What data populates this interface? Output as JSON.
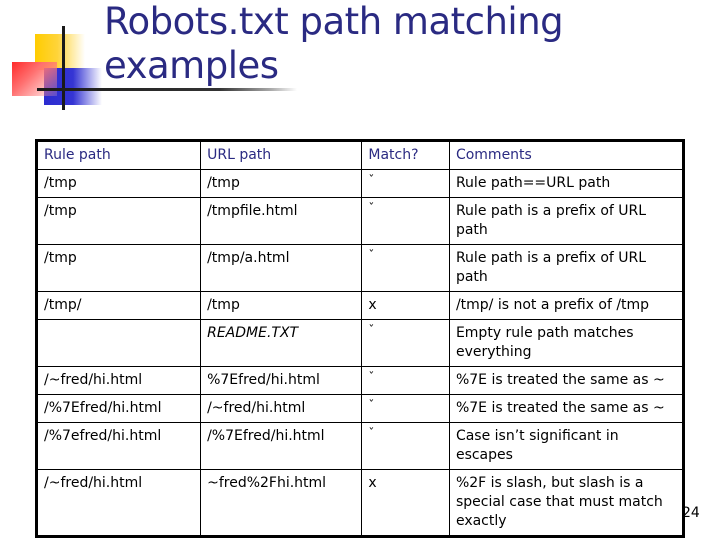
{
  "slide": {
    "title_line1": "Robots.txt path matching",
    "title_line2": "examples",
    "page_number": "24",
    "accent_color": "#2a2a82"
  },
  "table": {
    "headers": [
      "Rule path",
      "URL path",
      "Match?",
      "Comments"
    ],
    "rows": [
      {
        "rule": "/tmp",
        "url": "/tmp",
        "match": "ˇ",
        "match_icon": "check-mark",
        "comment": "Rule path==URL path"
      },
      {
        "rule": "/tmp",
        "url": "/tmpfile.html",
        "match": "ˇ",
        "match_icon": "check-mark",
        "comment": "Rule path is a prefix of URL path"
      },
      {
        "rule": "/tmp",
        "url": "/tmp/a.html",
        "match": "ˇ",
        "match_icon": "check-mark",
        "comment": "Rule path is a prefix of URL path"
      },
      {
        "rule": "/tmp/",
        "url": "/tmp",
        "match": "x",
        "match_icon": "x-mark",
        "comment": "/tmp/ is not  a prefix of /tmp"
      },
      {
        "rule": "",
        "url": "README.TXT",
        "match": "ˇ",
        "match_icon": "check-mark",
        "comment": "Empty rule path matches everything"
      },
      {
        "rule": "/~fred/hi.html",
        "url": "%7Efred/hi.html",
        "match": "ˇ",
        "match_icon": "check-mark",
        "comment": "%7E is treated the same as ~"
      },
      {
        "rule": "/%7Efred/hi.html",
        "url": "/~fred/hi.html",
        "match": "ˇ",
        "match_icon": "check-mark",
        "comment": "%7E is treated the same as ~"
      },
      {
        "rule": "/%7efred/hi.html",
        "url": "/%7Efred/hi.html",
        "match": "ˇ",
        "match_icon": "check-mark",
        "comment": "Case isn’t significant in escapes"
      },
      {
        "rule": "/~fred/hi.html",
        "url": "~fred%2Fhi.html",
        "match": "x",
        "match_icon": "x-mark",
        "comment": "%2F is slash, but slash is a special case that must match exactly"
      }
    ]
  }
}
